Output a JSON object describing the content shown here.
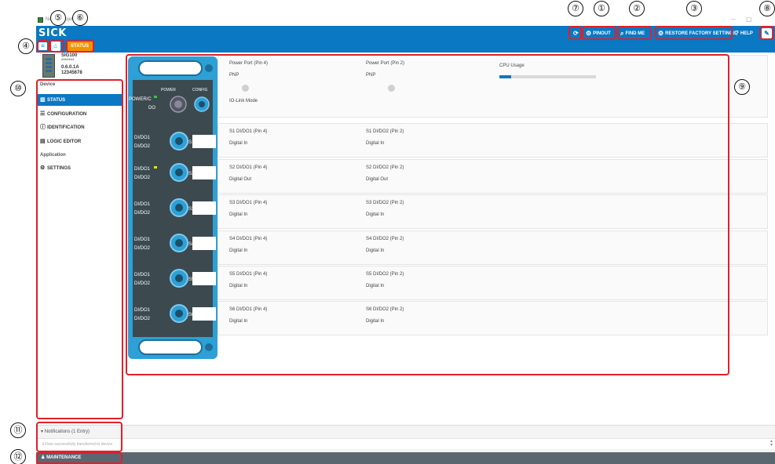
{
  "window": {
    "title": "SICK Gateway · Neues Projekt",
    "title_visible": "Neues Projekt",
    "controls": [
      "–",
      "▢"
    ]
  },
  "brand": {
    "logo": "SICK"
  },
  "toolbar": {
    "refresh_icon": "refresh-icon",
    "pinout_label": "PINOUT",
    "find_me_label": "FIND ME",
    "restore_label": "RESTORE FACTORY SETTINGS",
    "help_label": "HELP",
    "help_icon": "?",
    "edit_icon": "pencil-icon"
  },
  "nav": {
    "menu_icon": "≡",
    "home_icon": "⌂",
    "breadcrumb": "STATUS"
  },
  "device": {
    "name": "SIG100",
    "password": "*******",
    "version": "0.6.0.1A",
    "serial": "12345678"
  },
  "sidebar": {
    "section_device": "Device",
    "section_application": "Application",
    "items": [
      {
        "label": "STATUS",
        "icon": "bar-chart-icon",
        "active": true
      },
      {
        "label": "CONFIGURATION",
        "icon": "list-icon",
        "active": false
      },
      {
        "label": "IDENTIFICATION",
        "icon": "info-icon",
        "active": false
      },
      {
        "label": "LOGIC EDITOR",
        "icon": "document-icon",
        "active": false
      },
      {
        "label": "SETTINGS",
        "icon": "cogs-icon",
        "active": false
      }
    ]
  },
  "device_image": {
    "labels": {
      "power": "POWER",
      "config": "CONFIG",
      "power_c": "POWER/C",
      "do": "DO",
      "dido1": "DI/DO1",
      "dido2": "DI/DO2"
    },
    "ports": [
      "S1",
      "S2",
      "S3",
      "S4",
      "S5",
      "S6"
    ]
  },
  "power_panel": {
    "col1_label": "Power Port (Pin 4)",
    "col1_value": "PNP",
    "col2_label": "Power Port (Pin 2)",
    "col2_value": "PNP",
    "mode_label": "IO-Link Mode",
    "cpu_label": "CPU Usage",
    "cpu_usage_fraction": 0.12
  },
  "port_panels": [
    {
      "pin4_label": "S1 DI/DO1 (Pin 4)",
      "pin4_value": "Digital In",
      "pin2_label": "S1 DI/DO2 (Pin 2)",
      "pin2_value": "Digital In"
    },
    {
      "pin4_label": "S2 DI/DO1 (Pin 4)",
      "pin4_value": "Digital Out",
      "pin2_label": "S2 DI/DO2 (Pin 2)",
      "pin2_value": "Digital Out"
    },
    {
      "pin4_label": "S3 DI/DO1 (Pin 4)",
      "pin4_value": "Digital In",
      "pin2_label": "S3 DI/DO2 (Pin 2)",
      "pin2_value": "Digital In"
    },
    {
      "pin4_label": "S4 DI/DO1 (Pin 4)",
      "pin4_value": "Digital In",
      "pin2_label": "S4 DI/DO2 (Pin 2)",
      "pin2_value": "Digital In"
    },
    {
      "pin4_label": "S5 DI/DO1 (Pin 4)",
      "pin4_value": "Digital In",
      "pin2_label": "S5 DI/DO2 (Pin 2)",
      "pin2_value": "Digital In"
    },
    {
      "pin4_label": "S6 DI/DO1 (Pin 4)",
      "pin4_value": "Digital In",
      "pin2_label": "S6 DI/DO2 (Pin 2)",
      "pin2_value": "Digital In"
    }
  ],
  "notifications": {
    "header": "Notifications (1 Entry)",
    "message": "Flow successfully transferred to device"
  },
  "maintenance": {
    "label": "MAINTENANCE"
  },
  "annotations": [
    "①",
    "②",
    "③",
    "④",
    "⑤",
    "⑥",
    "⑦",
    "⑧",
    "⑨",
    "⑩",
    "⑪",
    "⑫"
  ],
  "colors": {
    "primary": "#0a78c2",
    "accent": "#f29400",
    "annotation_red": "#e0202a",
    "maintenance_bar": "#5b6770",
    "led_green": "#2ecc40",
    "led_yellow": "#ffdc00"
  }
}
